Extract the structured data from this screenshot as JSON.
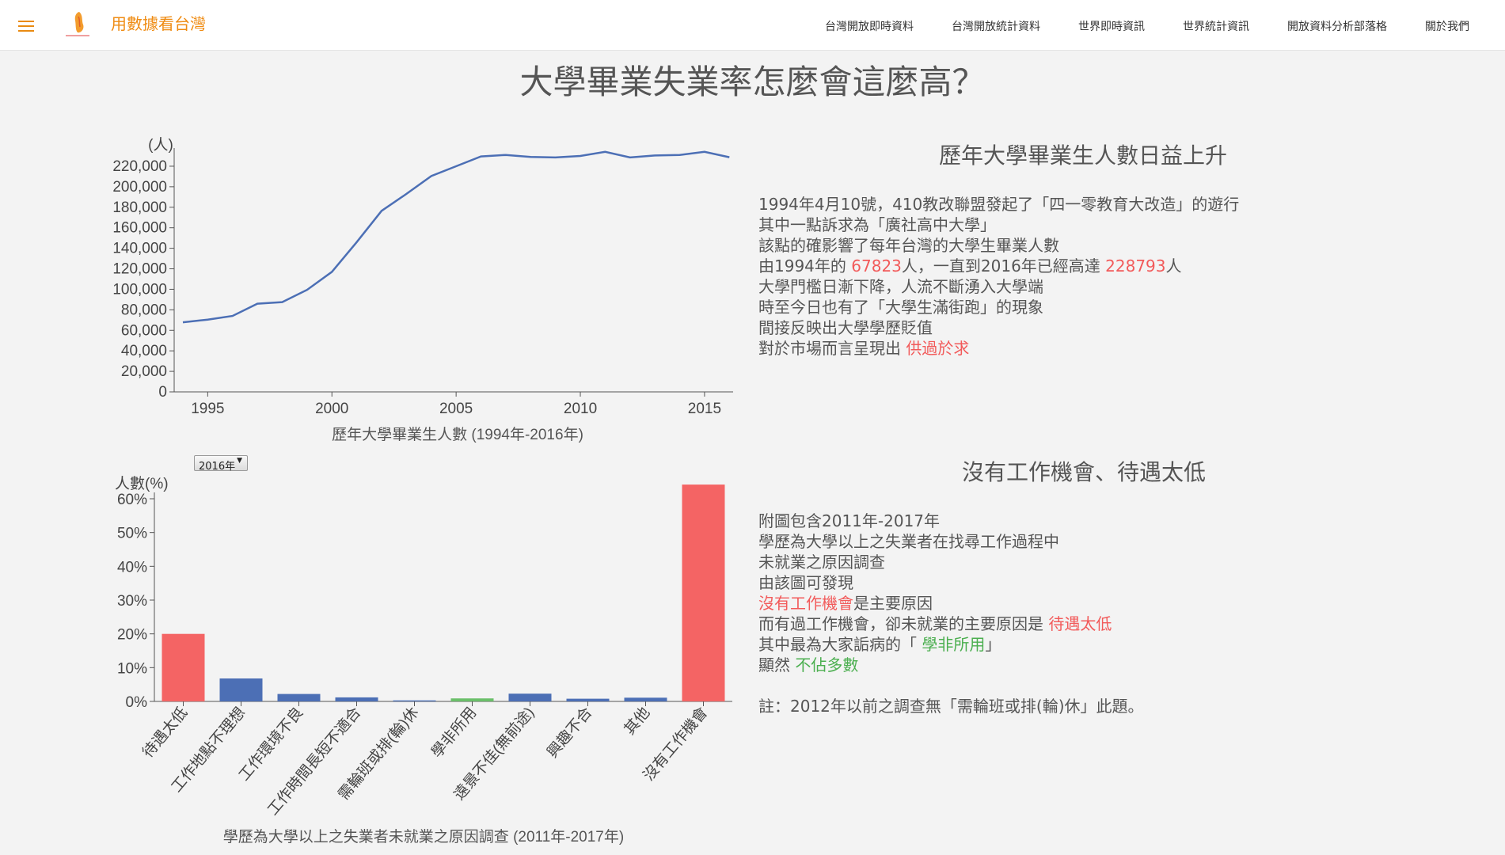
{
  "nav": {
    "menu_icon": "hamburger-menu-icon",
    "logo_icon": "taiwan-logo-icon",
    "site_title": "用數據看台灣",
    "items": [
      {
        "label": "台灣開放即時資料"
      },
      {
        "label": "台灣開放統計資料"
      },
      {
        "label": "世界即時資訊"
      },
      {
        "label": "世界統計資訊"
      },
      {
        "label": "開放資料分析部落格"
      },
      {
        "label": "關於我們"
      }
    ]
  },
  "page": {
    "title": "大學畢業失業率怎麼會這麼高？"
  },
  "section1": {
    "title": "歷年大學畢業生人數日益上升",
    "lines": [
      {
        "text": "1994年4月10號，410教改聯盟發起了「四一零教育大改造」的遊行"
      },
      {
        "text": "其中一點訴求為「廣社高中大學」"
      },
      {
        "text": "該點的確影響了每年台灣的大學生畢業人數"
      },
      {
        "pre": "由1994年的 ",
        "hl1": "67823",
        "mid": "人，一直到2016年已經高達 ",
        "hl2": "228793",
        "post": "人"
      },
      {
        "text": "大學門檻日漸下降，人流不斷湧入大學端"
      },
      {
        "text": "時至今日也有了「大學生滿街跑」的現象"
      },
      {
        "text": "間接反映出大學學歷貶值"
      },
      {
        "pre": "對於市場而言呈現出 ",
        "hl": "供過於求"
      }
    ]
  },
  "section2": {
    "title": "沒有工作機會、待遇太低",
    "lines": [
      {
        "text": "附圖包含2011年-2017年"
      },
      {
        "text": "學歷為大學以上之失業者在找尋工作過程中"
      },
      {
        "text": "未就業之原因調查"
      },
      {
        "text": "由該圖可發現"
      },
      {
        "hl": "沒有工作機會",
        "post": "是主要原因"
      },
      {
        "pre": "而有過工作機會，卻未就業的主要原因是 ",
        "hl": "待遇太低"
      },
      {
        "pre": "其中最為大家詬病的「 ",
        "hl": "學非所用",
        "post": "」"
      },
      {
        "pre": "顯然 ",
        "hl": "不佔多數"
      },
      {
        "text": "註：2012年以前之調查無「需輪班或排(輪)休」此題。"
      }
    ]
  },
  "year_select": {
    "value": "2016年"
  },
  "colors": {
    "line": "#4c6fb5",
    "red": "#f46464",
    "blue": "#4c6fb5",
    "green": "#6abf69",
    "accent": "#ef8b12"
  },
  "chart_data": [
    {
      "type": "line",
      "title": "歷年大學畢業生人數 (1994年-2016年)",
      "ylabel": "(人)",
      "x": [
        1994,
        1995,
        1996,
        1997,
        1998,
        1999,
        2000,
        2001,
        2002,
        2003,
        2004,
        2005,
        2006,
        2007,
        2008,
        2009,
        2010,
        2011,
        2012,
        2013,
        2014,
        2015,
        2016
      ],
      "y": [
        67823,
        70500,
        74000,
        86000,
        87500,
        99500,
        117000,
        146000,
        176500,
        193000,
        210500,
        220000,
        229500,
        231000,
        229000,
        228500,
        230000,
        234000,
        228500,
        230500,
        231000,
        234000,
        228793
      ],
      "xticks": [
        1995,
        2000,
        2005,
        2010,
        2015
      ],
      "yticks": [
        0,
        20000,
        40000,
        60000,
        80000,
        100000,
        120000,
        140000,
        160000,
        180000,
        200000,
        220000
      ],
      "ylim": [
        0,
        230000
      ],
      "grid": false,
      "legend": false
    },
    {
      "type": "bar",
      "title": "學歷為大學以上之失業者未就業之原因調查 (2011年-2017年)",
      "ylabel": "人數(%)",
      "categories": [
        "待遇太低",
        "工作地點不理想",
        "工作環境不良",
        "工作時間長短不適合",
        "需輪班或排(輪)休",
        "學非所用",
        "遠景不佳(無前途)",
        "興趣不合",
        "其他",
        "沒有工作機會"
      ],
      "values": [
        20.0,
        6.8,
        2.2,
        1.2,
        0.3,
        0.9,
        2.3,
        0.8,
        1.1,
        64.2
      ],
      "colors": [
        "red",
        "blue",
        "blue",
        "blue",
        "blue",
        "green",
        "blue",
        "blue",
        "blue",
        "red"
      ],
      "yticks": [
        0,
        10,
        20,
        30,
        40,
        50,
        60
      ],
      "ylim": [
        0,
        60
      ],
      "grid": false,
      "legend": false
    }
  ]
}
